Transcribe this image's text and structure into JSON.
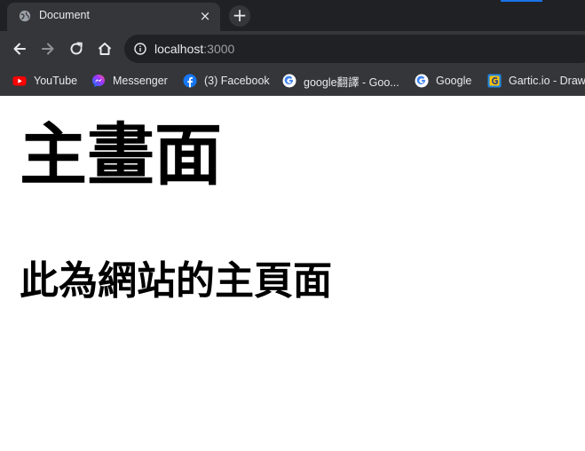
{
  "tab": {
    "title": "Document",
    "close_glyph": "×",
    "favicon": "globe-icon"
  },
  "new_tab": {
    "glyph": "+"
  },
  "toolbar": {
    "url_host": "localhost",
    "url_port": ":3000",
    "icons": [
      "back-arrow-icon",
      "forward-arrow-icon",
      "reload-icon",
      "home-icon",
      "info-icon"
    ]
  },
  "bookmarks": [
    {
      "label": "YouTube",
      "icon": "youtube-icon"
    },
    {
      "label": "Messenger",
      "icon": "messenger-icon"
    },
    {
      "label": "(3) Facebook",
      "icon": "facebook-icon"
    },
    {
      "label": "google翻譯 - Goo...",
      "icon": "google-icon"
    },
    {
      "label": "Google",
      "icon": "google-icon"
    },
    {
      "label": "Gartic.io - Draw",
      "icon": "gartic-icon"
    }
  ],
  "page": {
    "heading": "主畫面",
    "subheading": "此為網站的主頁面"
  },
  "colors": {
    "tabstrip_bg": "#202124",
    "toolbar_bg": "#35363a",
    "omnibox_bg": "#202124",
    "text_light": "#e8eaed",
    "text_dim": "#9aa0a6",
    "page_bg": "#ffffff"
  }
}
